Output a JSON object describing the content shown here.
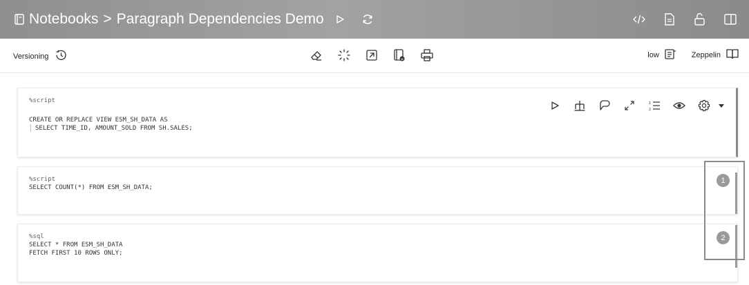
{
  "titlebar": {
    "breadcrumb_root": "Notebooks",
    "separator": ">",
    "notebook_name": "Paragraph Dependencies Demo",
    "icons": [
      "notebook-icon",
      "run-all-icon",
      "refresh-icon",
      "code-icon",
      "document-icon",
      "unlock-icon",
      "panel-icon"
    ]
  },
  "toolbar": {
    "versioning_label": "Versioning",
    "center_icons": [
      "eraser-icon",
      "magic-icon",
      "export-icon",
      "import-icon",
      "print-icon"
    ],
    "interpreter_label": "low",
    "zeppelin_label": "Zeppelin"
  },
  "paragraphs": [
    {
      "interpreter": "%script",
      "code_line_1": "CREATE OR REPLACE VIEW ESM_SH_DATA AS",
      "code_line_2": "SELECT TIME_ID, AMOUNT_SOLD FROM SH.SALES;",
      "tools": [
        "run-icon",
        "hierarchy-icon",
        "comment-icon",
        "expand-icon",
        "line-numbers-icon",
        "visibility-icon",
        "settings-icon",
        "caret-down-icon"
      ]
    },
    {
      "interpreter": "%script",
      "code_line_1": "SELECT COUNT(*) FROM ESM_SH_DATA;",
      "badge": "1"
    },
    {
      "interpreter": "%sql",
      "code_line_1": "SELECT * FROM ESM_SH_DATA",
      "code_line_2": "FETCH FIRST 10 ROWS ONLY;",
      "badge": "2"
    }
  ],
  "colors": {
    "titlebar": "#999999",
    "badge": "#9a9a9a",
    "highlight": "#8a8a8a"
  }
}
